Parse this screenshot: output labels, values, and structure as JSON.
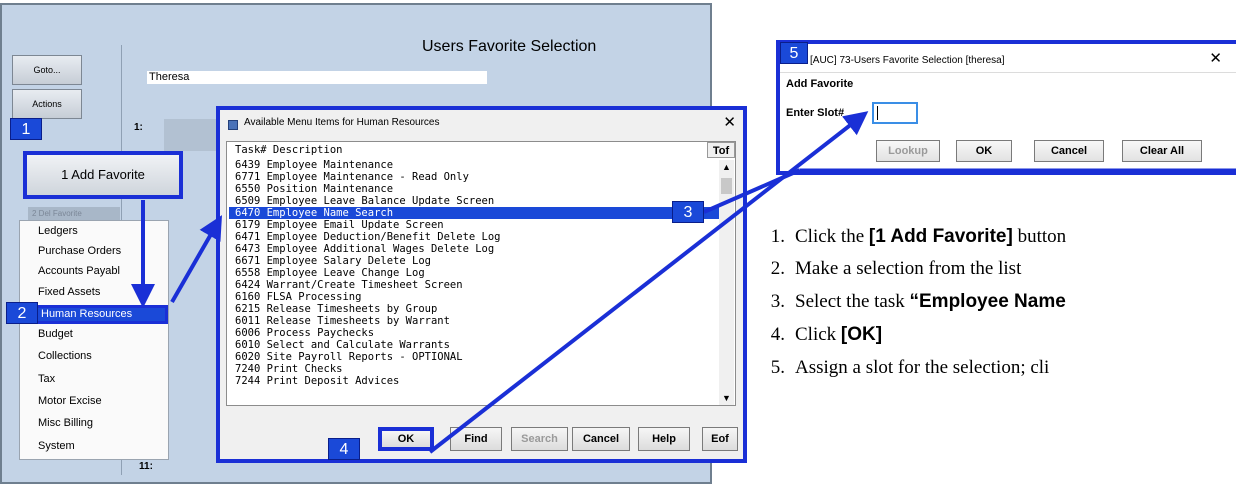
{
  "app": {
    "title": "Users Favorite Selection",
    "goto_label": "Goto...",
    "actions_label": "Actions",
    "user": "Theresa",
    "slot1_label": "1:",
    "slot2_label": "11:"
  },
  "add_favorite_label": "1 Add Favorite",
  "del_favorite_label": "2 Del Favorite",
  "menu_items": [
    "Ledgers",
    "Purchase Orders",
    "Accounts Payabl",
    "Fixed Assets",
    "Human Resources",
    "Budget",
    "Collections",
    "Tax",
    "Motor Excise",
    "Misc Billing",
    "System"
  ],
  "task_dialog": {
    "title": "Available Menu Items for Human Resources",
    "header": "Task# Description",
    "tof": "Tof",
    "rows": [
      "6439 Employee Maintenance",
      "6771 Employee Maintenance - Read Only",
      "6550 Position Maintenance",
      "6509 Employee Leave Balance Update Screen",
      "6470 Employee Name Search",
      "6179 Employee Email Update Screen",
      "6471 Employee Deduction/Benefit Delete Log",
      "6473 Employee Additional Wages Delete Log",
      "6671 Employee Salary Delete Log",
      "6558 Employee Leave Change Log",
      "6424 Warrant/Create Timesheet Screen",
      "6160 FLSA Processing",
      "6215 Release Timesheets by Group",
      "6011 Release Timesheets by Warrant",
      "6006 Process Paychecks",
      "6010 Select and Calculate Warrants",
      "6020 Site Payroll Reports - OPTIONAL",
      "7240 Print Checks",
      "7244 Print Deposit Advices"
    ],
    "buttons": {
      "ok": "OK",
      "find": "Find",
      "search": "Search",
      "cancel": "Cancel",
      "help": "Help",
      "eof": "Eof"
    }
  },
  "slot_dialog": {
    "title": "[AUC] 73-Users Favorite Selection [theresa]",
    "subtitle": "Add Favorite",
    "enter_label": "Enter Slot#",
    "value": "",
    "buttons": {
      "lookup": "Lookup",
      "ok": "OK",
      "cancel": "Cancel",
      "clear_all": "Clear All"
    }
  },
  "badges": [
    "1",
    "2",
    "3",
    "4",
    "5"
  ],
  "instructions": [
    {
      "num": "1.",
      "pre": "Click the ",
      "bold": "[1 Add Favorite]",
      "post": " button"
    },
    {
      "num": "2.",
      "pre": "Make a selection from the list",
      "bold": "",
      "post": ""
    },
    {
      "num": "3.",
      "pre": "Select the task ",
      "bold": "“Employee Name",
      "post": ""
    },
    {
      "num": "4.",
      "pre": "Click ",
      "bold": "[OK]",
      "post": ""
    },
    {
      "num": "5.",
      "pre": "Assign a slot for the selection; cli",
      "bold": "",
      "post": ""
    }
  ],
  "colors": {
    "highlight": "#1a49d8",
    "annotation": "#1a2fd6",
    "app_bg": "#c3d3e6"
  }
}
